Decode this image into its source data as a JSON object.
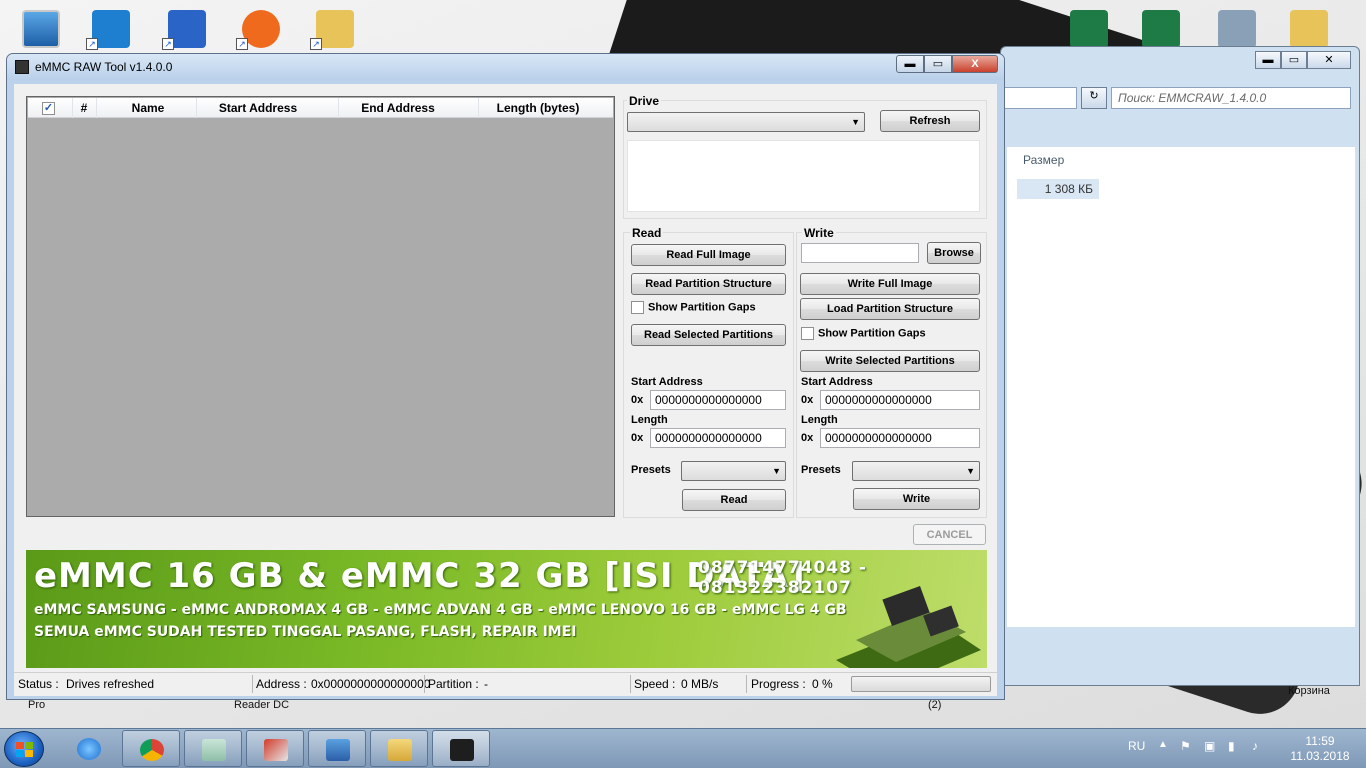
{
  "app": {
    "title": "eMMC RAW Tool v1.4.0.0",
    "window_buttons": {
      "minimize": "▬",
      "maximize": "▭",
      "close": "X"
    }
  },
  "partition_table": {
    "columns": [
      "#",
      "Name",
      "Start Address",
      "End Address",
      "Length (bytes)"
    ],
    "select_all_checked": true,
    "select_all_mark": "✓",
    "rows": []
  },
  "drive": {
    "label": "Drive",
    "selected": "",
    "refresh_label": "Refresh",
    "info_text": ""
  },
  "read": {
    "label": "Read",
    "full_image_label": "Read Full Image",
    "partition_structure_label": "Read Partition Structure",
    "show_gaps_label": "Show Partition Gaps",
    "show_gaps_checked": false,
    "selected_partitions_label": "Read Selected Partitions",
    "start_address_label": "Start Address",
    "start_prefix": "0x",
    "start_address": "0000000000000000",
    "length_label": "Length",
    "length_prefix": "0x",
    "length": "0000000000000000",
    "presets_label": "Presets",
    "preset_selected": "",
    "action_label": "Read"
  },
  "write": {
    "label": "Write",
    "file_path": "",
    "browse_label": "Browse",
    "full_image_label": "Write Full Image",
    "load_partition_structure_label": "Load Partition Structure",
    "show_gaps_label": "Show Partition Gaps",
    "show_gaps_checked": false,
    "selected_partitions_label": "Write Selected Partitions",
    "start_address_label": "Start Address",
    "start_prefix": "0x",
    "start_address": "0000000000000000",
    "length_label": "Length",
    "length_prefix": "0x",
    "length": "0000000000000000",
    "presets_label": "Presets",
    "preset_selected": "",
    "action_label": "Write"
  },
  "cancel_label": "CANCEL",
  "banner": {
    "title": "eMMC 16 GB & eMMC 32 GB [ISI DATA]",
    "phones": "087714774048 - 081322382107",
    "line1": "eMMC SAMSUNG - eMMC ANDROMAX 4 GB - eMMC ADVAN 4 GB - eMMC LENOVO 16 GB - eMMC LG 4 GB",
    "line2": "SEMUA eMMC SUDAH TESTED TINGGAL PASANG, FLASH, REPAIR IMEI"
  },
  "status_bar": {
    "status_label": "Status :",
    "status_value": "Drives refreshed",
    "address_label": "Address :",
    "address_value": "0x0000000000000000",
    "partition_label": "Partition :",
    "partition_value": "-",
    "speed_label": "Speed :",
    "speed_value": "0 MB/s",
    "progress_label": "Progress :",
    "progress_value": "0 %",
    "progress_fraction": 0
  },
  "explorer_bg": {
    "search_placeholder": "Поиск: EMMCRAW_1.4.0.0",
    "size_column": "Размер",
    "file_size": "1 308 КБ"
  },
  "desktop": {
    "labels": [
      "Pro",
      "Reader DC",
      "(2)",
      "Корзина"
    ]
  },
  "taskbar": {
    "language": "RU",
    "time": "11:59",
    "date": "11.03.2018"
  },
  "colors": {
    "window_frame": "#bcd2ea",
    "client_bg": "#f0f0f0",
    "table_bg": "#ababab",
    "banner_green": "#79b826",
    "taskbar": "#8ea7c3"
  }
}
